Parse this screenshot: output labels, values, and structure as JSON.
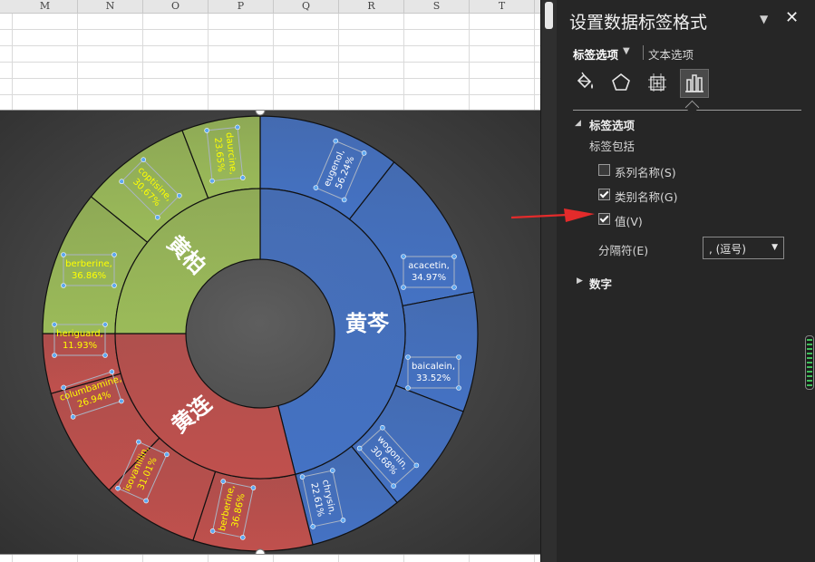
{
  "sheet": {
    "columns": [
      "M",
      "N",
      "O",
      "P",
      "Q",
      "R",
      "S",
      "T"
    ]
  },
  "chart_data": {
    "type": "doughnut",
    "inner_ring": [
      {
        "label": "黄芩",
        "color": "#4472c4"
      },
      {
        "label": "黄连",
        "color": "#c0504d"
      },
      {
        "label": "黄柏",
        "color": "#9bbb59"
      }
    ],
    "outer_ring": [
      {
        "parent": "黄芩",
        "label": "eugenol,",
        "value": "56.24%"
      },
      {
        "parent": "黄芩",
        "label": "acacetin,",
        "value": "34.97%"
      },
      {
        "parent": "黄芩",
        "label": "baicalein,",
        "value": "33.52%"
      },
      {
        "parent": "黄芩",
        "label": "wogonin,",
        "value": "30.68%"
      },
      {
        "parent": "黄芩",
        "label": "chrysin,",
        "value": "22.61%"
      },
      {
        "parent": "黄连",
        "label": "berberine,",
        "value": "36.86%"
      },
      {
        "parent": "黄连",
        "label": "isovanillin,",
        "value": "31.01%"
      },
      {
        "parent": "黄连",
        "label": "columbamine,",
        "value": "26.94%"
      },
      {
        "parent": "黄连",
        "label": "heriguard,",
        "value": "11.93%"
      },
      {
        "parent": "黄柏",
        "label": "berberine,",
        "value": "36.86%"
      },
      {
        "parent": "黄柏",
        "label": "coptisine,",
        "value": "30.67%"
      },
      {
        "parent": "黄柏",
        "label": "daurcine,",
        "value": "23.65%"
      }
    ],
    "label_color_light": "#ffff00",
    "label_color_dark": "#ffffff"
  },
  "pane": {
    "title": "设置数据标签格式",
    "dropdown_icon": "chevron-down-icon",
    "close": "✕",
    "tabs": {
      "label_options": "标签选项",
      "text_options": "文本选项"
    },
    "section_label_options": "标签选项",
    "label_contains": "标签包括",
    "checkboxes": [
      {
        "text": "系列名称(S)",
        "checked": false
      },
      {
        "text": "类别名称(G)",
        "checked": true
      },
      {
        "text": "值(V)",
        "checked": true
      }
    ],
    "separator_label": "分隔符(E)",
    "separator_value": ", (逗号)",
    "section_number": "数字"
  },
  "colors": {
    "pane_bg": "#262626",
    "accent_red": "#e32b2b",
    "scroll_green": "#3fbf5a"
  }
}
